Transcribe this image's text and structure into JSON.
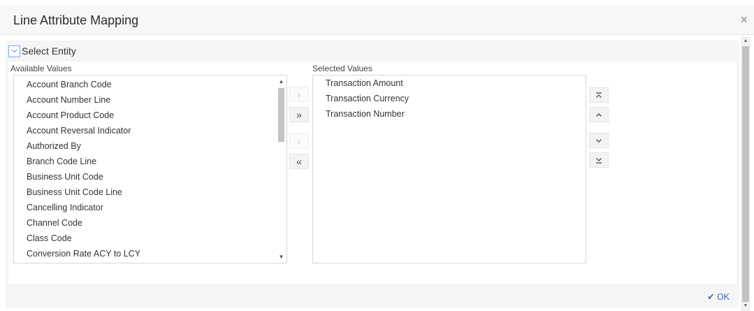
{
  "dialog": {
    "title": "Line Attribute Mapping",
    "close_glyph": "×"
  },
  "entity": {
    "label": "Select Entity",
    "icon": "chevron-down-icon"
  },
  "available": {
    "label": "Available Values",
    "items": [
      "Account Branch Code",
      "Account Number Line",
      "Account Product Code",
      "Account Reversal Indicator",
      "Authorized By",
      "Branch Code Line",
      "Business Unit Code",
      "Business Unit Code Line",
      "Cancelling Indicator",
      "Channel Code",
      "Class Code",
      "Conversion Rate ACY to LCY"
    ]
  },
  "selected": {
    "label": "Selected Values",
    "items": [
      "Transaction Amount",
      "Transaction Currency",
      "Transaction Number"
    ]
  },
  "move_buttons": {
    "move_right": "›",
    "move_all_right": "»",
    "move_left": "‹",
    "move_all_left": "«"
  },
  "order_buttons": {
    "move_top": "⤒",
    "move_up": "^",
    "move_down": "⌄",
    "move_bottom": "⤓"
  },
  "footer": {
    "ok_label": "OK",
    "ok_icon": "check-icon"
  },
  "colors": {
    "accent": "#3a6fa8",
    "focus_border": "#7fa7d9"
  }
}
